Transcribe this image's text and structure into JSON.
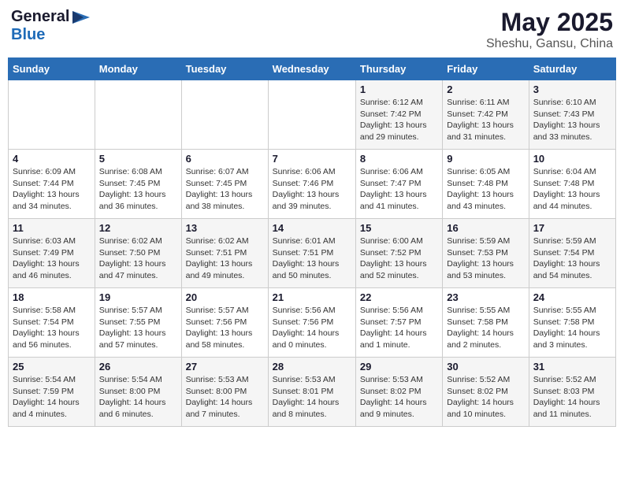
{
  "header": {
    "logo": {
      "general": "General",
      "blue": "Blue"
    },
    "title": "May 2025",
    "location": "Sheshu, Gansu, China"
  },
  "weekdays": [
    "Sunday",
    "Monday",
    "Tuesday",
    "Wednesday",
    "Thursday",
    "Friday",
    "Saturday"
  ],
  "weeks": [
    [
      {
        "day": "",
        "content": ""
      },
      {
        "day": "",
        "content": ""
      },
      {
        "day": "",
        "content": ""
      },
      {
        "day": "",
        "content": ""
      },
      {
        "day": "1",
        "content": "Sunrise: 6:12 AM\nSunset: 7:42 PM\nDaylight: 13 hours\nand 29 minutes."
      },
      {
        "day": "2",
        "content": "Sunrise: 6:11 AM\nSunset: 7:42 PM\nDaylight: 13 hours\nand 31 minutes."
      },
      {
        "day": "3",
        "content": "Sunrise: 6:10 AM\nSunset: 7:43 PM\nDaylight: 13 hours\nand 33 minutes."
      }
    ],
    [
      {
        "day": "4",
        "content": "Sunrise: 6:09 AM\nSunset: 7:44 PM\nDaylight: 13 hours\nand 34 minutes."
      },
      {
        "day": "5",
        "content": "Sunrise: 6:08 AM\nSunset: 7:45 PM\nDaylight: 13 hours\nand 36 minutes."
      },
      {
        "day": "6",
        "content": "Sunrise: 6:07 AM\nSunset: 7:45 PM\nDaylight: 13 hours\nand 38 minutes."
      },
      {
        "day": "7",
        "content": "Sunrise: 6:06 AM\nSunset: 7:46 PM\nDaylight: 13 hours\nand 39 minutes."
      },
      {
        "day": "8",
        "content": "Sunrise: 6:06 AM\nSunset: 7:47 PM\nDaylight: 13 hours\nand 41 minutes."
      },
      {
        "day": "9",
        "content": "Sunrise: 6:05 AM\nSunset: 7:48 PM\nDaylight: 13 hours\nand 43 minutes."
      },
      {
        "day": "10",
        "content": "Sunrise: 6:04 AM\nSunset: 7:48 PM\nDaylight: 13 hours\nand 44 minutes."
      }
    ],
    [
      {
        "day": "11",
        "content": "Sunrise: 6:03 AM\nSunset: 7:49 PM\nDaylight: 13 hours\nand 46 minutes."
      },
      {
        "day": "12",
        "content": "Sunrise: 6:02 AM\nSunset: 7:50 PM\nDaylight: 13 hours\nand 47 minutes."
      },
      {
        "day": "13",
        "content": "Sunrise: 6:02 AM\nSunset: 7:51 PM\nDaylight: 13 hours\nand 49 minutes."
      },
      {
        "day": "14",
        "content": "Sunrise: 6:01 AM\nSunset: 7:51 PM\nDaylight: 13 hours\nand 50 minutes."
      },
      {
        "day": "15",
        "content": "Sunrise: 6:00 AM\nSunset: 7:52 PM\nDaylight: 13 hours\nand 52 minutes."
      },
      {
        "day": "16",
        "content": "Sunrise: 5:59 AM\nSunset: 7:53 PM\nDaylight: 13 hours\nand 53 minutes."
      },
      {
        "day": "17",
        "content": "Sunrise: 5:59 AM\nSunset: 7:54 PM\nDaylight: 13 hours\nand 54 minutes."
      }
    ],
    [
      {
        "day": "18",
        "content": "Sunrise: 5:58 AM\nSunset: 7:54 PM\nDaylight: 13 hours\nand 56 minutes."
      },
      {
        "day": "19",
        "content": "Sunrise: 5:57 AM\nSunset: 7:55 PM\nDaylight: 13 hours\nand 57 minutes."
      },
      {
        "day": "20",
        "content": "Sunrise: 5:57 AM\nSunset: 7:56 PM\nDaylight: 13 hours\nand 58 minutes."
      },
      {
        "day": "21",
        "content": "Sunrise: 5:56 AM\nSunset: 7:56 PM\nDaylight: 14 hours\nand 0 minutes."
      },
      {
        "day": "22",
        "content": "Sunrise: 5:56 AM\nSunset: 7:57 PM\nDaylight: 14 hours\nand 1 minute."
      },
      {
        "day": "23",
        "content": "Sunrise: 5:55 AM\nSunset: 7:58 PM\nDaylight: 14 hours\nand 2 minutes."
      },
      {
        "day": "24",
        "content": "Sunrise: 5:55 AM\nSunset: 7:58 PM\nDaylight: 14 hours\nand 3 minutes."
      }
    ],
    [
      {
        "day": "25",
        "content": "Sunrise: 5:54 AM\nSunset: 7:59 PM\nDaylight: 14 hours\nand 4 minutes."
      },
      {
        "day": "26",
        "content": "Sunrise: 5:54 AM\nSunset: 8:00 PM\nDaylight: 14 hours\nand 6 minutes."
      },
      {
        "day": "27",
        "content": "Sunrise: 5:53 AM\nSunset: 8:00 PM\nDaylight: 14 hours\nand 7 minutes."
      },
      {
        "day": "28",
        "content": "Sunrise: 5:53 AM\nSunset: 8:01 PM\nDaylight: 14 hours\nand 8 minutes."
      },
      {
        "day": "29",
        "content": "Sunrise: 5:53 AM\nSunset: 8:02 PM\nDaylight: 14 hours\nand 9 minutes."
      },
      {
        "day": "30",
        "content": "Sunrise: 5:52 AM\nSunset: 8:02 PM\nDaylight: 14 hours\nand 10 minutes."
      },
      {
        "day": "31",
        "content": "Sunrise: 5:52 AM\nSunset: 8:03 PM\nDaylight: 14 hours\nand 11 minutes."
      }
    ]
  ]
}
